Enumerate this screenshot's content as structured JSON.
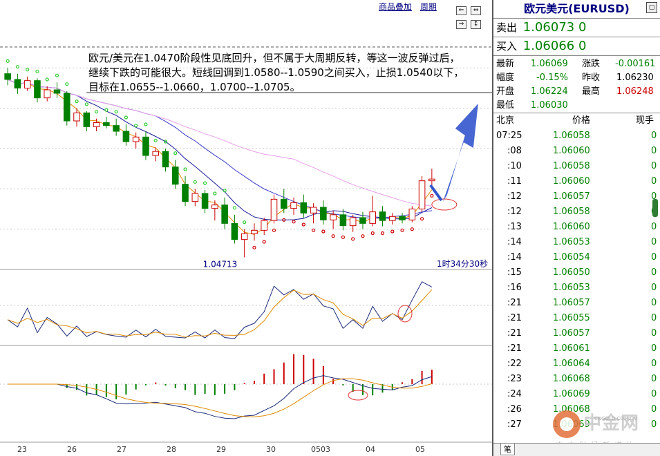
{
  "toolbar": {
    "overlay_label": "商品叠加",
    "period_label": "周期",
    "nav_buttons": [
      "⇐",
      "⇔",
      "⇒",
      "↕"
    ]
  },
  "annotation": {
    "lines": [
      "欧元/美元在1.0470阶段性见底回升，但不属于大周期反转，等这一波反弹过后，",
      "继续下跌的可能很大。短线回调到1.0580--1.0590之间买入，止损1.0540以下，",
      "目标在1.0655--1.0660，1.0700--1.0705。"
    ]
  },
  "chart_data": {
    "type": "candlestick",
    "title": "",
    "x_tick_labels": [
      "23",
      "26",
      "27",
      "28",
      "29",
      "30",
      "0503",
      "04",
      "05"
    ],
    "low_marker_label": "1.04713",
    "countdown_label": "1时34分30秒",
    "candles": [
      [
        1.079,
        1.08,
        1.077,
        1.078
      ],
      [
        1.078,
        1.079,
        1.0755,
        1.0765
      ],
      [
        1.0765,
        1.0785,
        1.076,
        1.0778
      ],
      [
        1.0778,
        1.0782,
        1.074,
        1.0748
      ],
      [
        1.0748,
        1.0768,
        1.0742,
        1.0762
      ],
      [
        1.0762,
        1.0775,
        1.0748,
        1.0756
      ],
      [
        1.0756,
        1.076,
        1.07,
        1.0708
      ],
      [
        1.0708,
        1.073,
        1.0698,
        1.0722
      ],
      [
        1.0722,
        1.0725,
        1.069,
        1.0698
      ],
      [
        1.0698,
        1.0712,
        1.069,
        1.0705
      ],
      [
        1.0705,
        1.0715,
        1.0695,
        1.07
      ],
      [
        1.07,
        1.0712,
        1.0682,
        1.069
      ],
      [
        1.069,
        1.0702,
        1.0665,
        1.0672
      ],
      [
        1.0672,
        1.0688,
        1.066,
        1.068
      ],
      [
        1.068,
        1.069,
        1.064,
        1.0648
      ],
      [
        1.0648,
        1.0662,
        1.0638,
        1.0655
      ],
      [
        1.0655,
        1.066,
        1.062,
        1.0628
      ],
      [
        1.0628,
        1.064,
        1.059,
        1.0598
      ],
      [
        1.0598,
        1.0612,
        1.056,
        1.0568
      ],
      [
        1.0568,
        1.059,
        1.056,
        1.0582
      ],
      [
        1.0582,
        1.0588,
        1.0548,
        1.0556
      ],
      [
        1.0556,
        1.057,
        1.0535,
        1.0562
      ],
      [
        1.0562,
        1.0575,
        1.052,
        1.053
      ],
      [
        1.053,
        1.0545,
        1.0495,
        1.0502
      ],
      [
        1.0502,
        1.052,
        1.0471,
        1.0512
      ],
      [
        1.0512,
        1.053,
        1.05,
        1.0518
      ],
      [
        1.0518,
        1.054,
        1.051,
        1.0535
      ],
      [
        1.0535,
        1.058,
        1.053,
        1.0572
      ],
      [
        1.0572,
        1.059,
        1.0548,
        1.0556
      ],
      [
        1.0556,
        1.0575,
        1.0545,
        1.0566
      ],
      [
        1.0566,
        1.058,
        1.054,
        1.0548
      ],
      [
        1.0548,
        1.0565,
        1.053,
        1.0558
      ],
      [
        1.0558,
        1.057,
        1.0528,
        1.0536
      ],
      [
        1.0536,
        1.0552,
        1.052,
        1.0545
      ],
      [
        1.0545,
        1.0555,
        1.0518,
        1.0526
      ],
      [
        1.0526,
        1.0545,
        1.0515,
        1.054
      ],
      [
        1.054,
        1.055,
        1.052,
        1.053
      ],
      [
        1.053,
        1.0578,
        1.0525,
        1.055
      ],
      [
        1.055,
        1.056,
        1.0525,
        1.0535
      ],
      [
        1.0535,
        1.0548,
        1.0528,
        1.0542
      ],
      [
        1.0542,
        1.0548,
        1.053,
        1.0536
      ],
      [
        1.0536,
        1.056,
        1.0532,
        1.0555
      ],
      [
        1.0555,
        1.0612,
        1.055,
        1.0604
      ],
      [
        1.0604,
        1.0625,
        1.059,
        1.0607
      ]
    ],
    "price_range": [
      1.045,
      1.087
    ],
    "indicators": [
      "MA",
      "SAR",
      "KDJ",
      "MACD"
    ],
    "grid": true
  },
  "quote_panel": {
    "title": "欧元美元(EURUSD)",
    "sell_label": "卖出",
    "sell_value": "1.06073 0",
    "buy_label": "买入",
    "buy_value": "1.06066 0",
    "stats": [
      {
        "label": "最新",
        "value": "1.06069",
        "label2": "涨跌",
        "value2": "-0.00161"
      },
      {
        "label": "幅度",
        "value": "-0.15%",
        "label2": "昨收",
        "value2": "1.06230"
      },
      {
        "label": "开盘",
        "value": "1.06224",
        "label2": "最高",
        "value2": "1.06248"
      },
      {
        "label": "最低",
        "value": "1.06030",
        "label2": "",
        "value2": ""
      }
    ],
    "ticks_header": {
      "time": "北京",
      "price": "价格",
      "volume": "现手"
    },
    "ticks": [
      {
        "time": "07:25",
        "price": "1.06058",
        "volume": "0"
      },
      {
        "time": ":08",
        "price": "1.06060",
        "volume": "0"
      },
      {
        "time": ":10",
        "price": "1.06058",
        "volume": "0"
      },
      {
        "time": ":11",
        "price": "1.06060",
        "volume": "0"
      },
      {
        "time": ":12",
        "price": "1.06057",
        "volume": "0"
      },
      {
        "time": ":12",
        "price": "1.06058",
        "volume": "0"
      },
      {
        "time": ":13",
        "price": "1.06060",
        "volume": "0"
      },
      {
        "time": ":14",
        "price": "1.06053",
        "volume": "0"
      },
      {
        "time": ":14",
        "price": "1.06054",
        "volume": "0"
      },
      {
        "time": ":15",
        "price": "1.06050",
        "volume": "0"
      },
      {
        "time": ":16",
        "price": "1.06053",
        "volume": "0"
      },
      {
        "time": ":21",
        "price": "1.06057",
        "volume": "0"
      },
      {
        "time": ":21",
        "price": "1.06055",
        "volume": "0"
      },
      {
        "time": ":21",
        "price": "1.06057",
        "volume": "0"
      },
      {
        "time": ":21",
        "price": "1.06061",
        "volume": "0"
      },
      {
        "time": ":22",
        "price": "1.06064",
        "volume": "0"
      },
      {
        "time": ":23",
        "price": "1.06068",
        "volume": "0"
      },
      {
        "time": ":24",
        "price": "1.06069",
        "volume": "0"
      },
      {
        "time": ":26",
        "price": "1.06068",
        "volume": "0"
      },
      {
        "time": ":27",
        "price": "1.06069",
        "volume": "0"
      }
    ],
    "footer_tab": "笔",
    "logo_text": "中金网",
    "logo_url": "CNGOLD.COM.CN",
    "logo_sub": "中文财经新媒体"
  },
  "colors": {
    "up": "#cc0000",
    "down": "#008000",
    "accent": "#3355cc",
    "title": "#000080"
  }
}
